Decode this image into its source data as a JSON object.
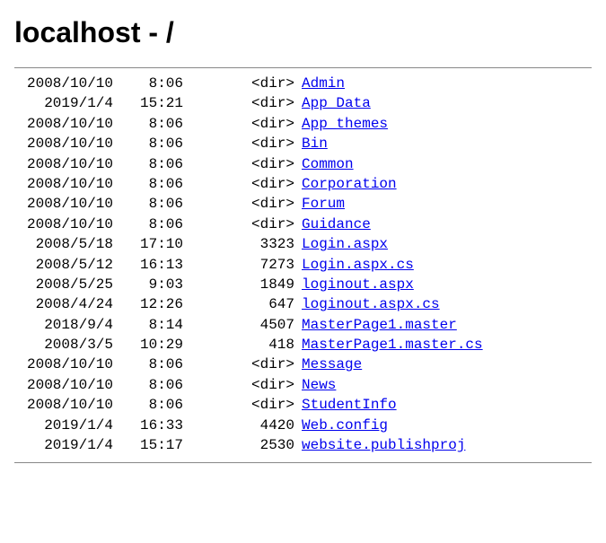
{
  "title": "localhost - /",
  "entries": [
    {
      "date": "2008/10/10",
      "time": "8:06",
      "size": "<dir>",
      "name": "Admin"
    },
    {
      "date": "2019/1/4",
      "time": "15:21",
      "size": "<dir>",
      "name": "App_Data"
    },
    {
      "date": "2008/10/10",
      "time": "8:06",
      "size": "<dir>",
      "name": "App_themes"
    },
    {
      "date": "2008/10/10",
      "time": "8:06",
      "size": "<dir>",
      "name": "Bin"
    },
    {
      "date": "2008/10/10",
      "time": "8:06",
      "size": "<dir>",
      "name": "Common"
    },
    {
      "date": "2008/10/10",
      "time": "8:06",
      "size": "<dir>",
      "name": "Corporation"
    },
    {
      "date": "2008/10/10",
      "time": "8:06",
      "size": "<dir>",
      "name": "Forum"
    },
    {
      "date": "2008/10/10",
      "time": "8:06",
      "size": "<dir>",
      "name": "Guidance"
    },
    {
      "date": "2008/5/18",
      "time": "17:10",
      "size": "3323",
      "name": "Login.aspx"
    },
    {
      "date": "2008/5/12",
      "time": "16:13",
      "size": "7273",
      "name": "Login.aspx.cs"
    },
    {
      "date": "2008/5/25",
      "time": "9:03",
      "size": "1849",
      "name": "loginout.aspx"
    },
    {
      "date": "2008/4/24",
      "time": "12:26",
      "size": "647",
      "name": "loginout.aspx.cs"
    },
    {
      "date": "2018/9/4",
      "time": "8:14",
      "size": "4507",
      "name": "MasterPage1.master"
    },
    {
      "date": "2008/3/5",
      "time": "10:29",
      "size": "418",
      "name": "MasterPage1.master.cs"
    },
    {
      "date": "2008/10/10",
      "time": "8:06",
      "size": "<dir>",
      "name": "Message"
    },
    {
      "date": "2008/10/10",
      "time": "8:06",
      "size": "<dir>",
      "name": "News"
    },
    {
      "date": "2008/10/10",
      "time": "8:06",
      "size": "<dir>",
      "name": "StudentInfo"
    },
    {
      "date": "2019/1/4",
      "time": "16:33",
      "size": "4420",
      "name": "Web.config"
    },
    {
      "date": "2019/1/4",
      "time": "15:17",
      "size": "2530",
      "name": "website.publishproj"
    }
  ]
}
